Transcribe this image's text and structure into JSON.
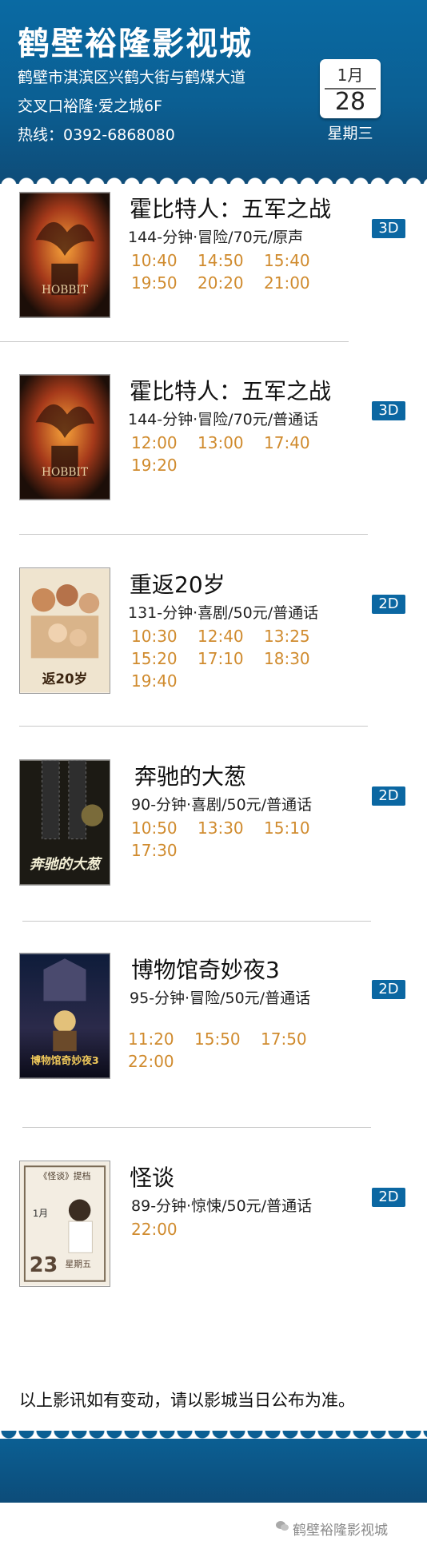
{
  "header": {
    "cinema_name": "鹤壁裕隆影视城",
    "address_line1": "鹤壁市淇滨区兴鹤大街与鹤煤大道",
    "address_line2": "交叉口裕隆·爱之城6F",
    "hotline": "热线：0392-6868080",
    "date_month": "1月",
    "date_day": "28",
    "weekday": "星期三"
  },
  "films": [
    {
      "title": "霍比特人：五军之战",
      "duration": "144",
      "genre_price_lang": "-分钟·冒险/70元/原声",
      "format": "3D",
      "times": [
        "10:40",
        "14:50",
        "15:40",
        "19:50",
        "20:20",
        "21:00"
      ],
      "poster_icon": "hobbit-poster"
    },
    {
      "title": "霍比特人：五军之战",
      "duration": "144",
      "genre_price_lang": "-分钟·冒险/70元/普通话",
      "format": "3D",
      "times": [
        "12:00",
        "13:00",
        "17:40",
        "19:20"
      ],
      "poster_icon": "hobbit-poster"
    },
    {
      "title": "重返20岁",
      "duration": "131",
      "genre_price_lang": "-分钟·喜剧/50元/普通话",
      "format": "2D",
      "times": [
        "10:30",
        "12:40",
        "13:25",
        "15:20",
        "17:10",
        "18:30",
        "19:40"
      ],
      "poster_icon": "miss-granny-poster"
    },
    {
      "title": "奔驰的大葱",
      "duration": "90",
      "genre_price_lang": "-分钟·喜剧/50元/普通话",
      "format": "2D",
      "times": [
        "10:50",
        "13:30",
        "15:10",
        "17:30"
      ],
      "poster_icon": "running-onion-poster"
    },
    {
      "title": "博物馆奇妙夜3",
      "duration": "95",
      "genre_price_lang": "-分钟·冒险/50元/普通话",
      "format": "2D",
      "times": [
        "11:20",
        "15:50",
        "17:50",
        "22:00"
      ],
      "poster_icon": "night-at-museum-poster"
    },
    {
      "title": "怪谈",
      "duration": "89",
      "genre_price_lang": "-分钟·惊悚/50元/普通话",
      "format": "2D",
      "times": [
        "22:00"
      ],
      "poster_icon": "guaitan-poster"
    }
  ],
  "notice": "以上影讯如有变动，请以影城当日公布为准。",
  "footer": {
    "watermark": "鹤壁裕隆影视城",
    "watermark_icon": "wechat-icon"
  },
  "colors": {
    "header_blue": "#0b5f93",
    "time_orange": "#d08b2e",
    "badge_blue": "#0b67a2"
  }
}
